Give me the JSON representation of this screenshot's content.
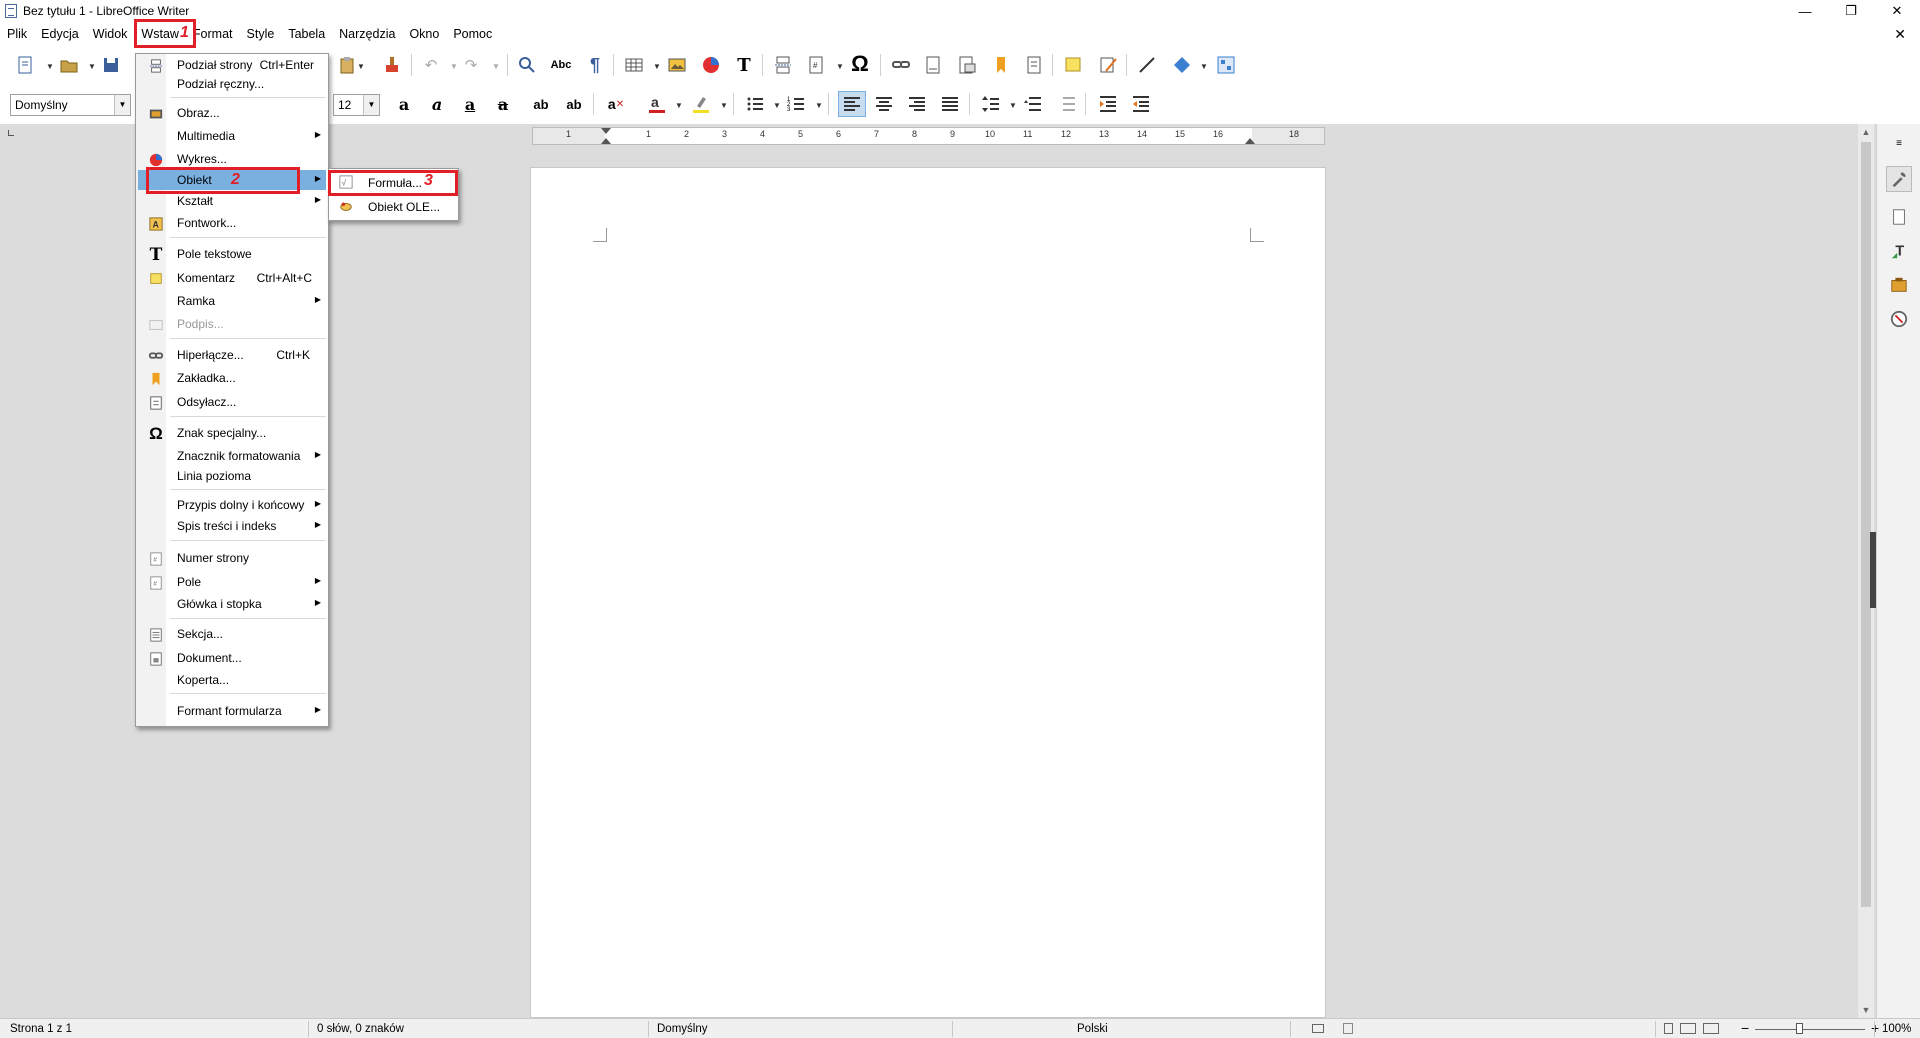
{
  "window": {
    "title": "Bez tytułu 1 - LibreOffice Writer",
    "min": "—",
    "max": "❐",
    "close": "✕",
    "doc_close": "✕"
  },
  "menubar": [
    "Plik",
    "Edycja",
    "Widok",
    "Wstaw",
    "Format",
    "Style",
    "Tabela",
    "Narzędzia",
    "Okno",
    "Pomoc"
  ],
  "formatting": {
    "para_style": "Domyślny",
    "font_size": "12"
  },
  "ruler": {
    "numbers": [
      "1",
      "1",
      "2",
      "3",
      "4",
      "5",
      "6",
      "7",
      "8",
      "9",
      "10",
      "11",
      "12",
      "13",
      "14",
      "15",
      "16",
      "18"
    ]
  },
  "insert_menu": [
    {
      "label": "Podział strony",
      "shortcut": "Ctrl+Enter"
    },
    {
      "label": "Podział ręczny..."
    },
    {
      "label": "Obraz..."
    },
    {
      "label": "Multimedia",
      "submenu": true
    },
    {
      "label": "Wykres..."
    },
    {
      "label": "Obiekt",
      "submenu": true
    },
    {
      "label": "Kształt",
      "submenu": true
    },
    {
      "label": "Fontwork..."
    },
    {
      "label": "Pole tekstowe"
    },
    {
      "label": "Komentarz",
      "shortcut": "Ctrl+Alt+C"
    },
    {
      "label": "Ramka",
      "submenu": true
    },
    {
      "label": "Podpis..."
    },
    {
      "label": "Hiperłącze...",
      "shortcut": "Ctrl+K"
    },
    {
      "label": "Zakładka..."
    },
    {
      "label": "Odsyłacz..."
    },
    {
      "label": "Znak specjalny..."
    },
    {
      "label": "Znacznik formatowania",
      "submenu": true
    },
    {
      "label": "Linia pozioma"
    },
    {
      "label": "Przypis dolny i końcowy",
      "submenu": true
    },
    {
      "label": "Spis treści i indeks",
      "submenu": true
    },
    {
      "label": "Numer strony"
    },
    {
      "label": "Pole",
      "submenu": true
    },
    {
      "label": "Główka i stopka",
      "submenu": true
    },
    {
      "label": "Sekcja..."
    },
    {
      "label": "Dokument..."
    },
    {
      "label": "Koperta..."
    },
    {
      "label": "Formant formularza",
      "submenu": true
    }
  ],
  "object_submenu": [
    {
      "label": "Formuła..."
    },
    {
      "label": "Obiekt OLE..."
    }
  ],
  "annotations": [
    "1",
    "2",
    "3"
  ],
  "statusbar": {
    "page": "Strona 1 z 1",
    "words": "0 słów, 0 znaków",
    "style": "Domyślny",
    "language": "Polski",
    "zoom": "100%"
  },
  "colors": {
    "highlight": "#7ab0e0",
    "annotation_red": "#e21e26"
  }
}
